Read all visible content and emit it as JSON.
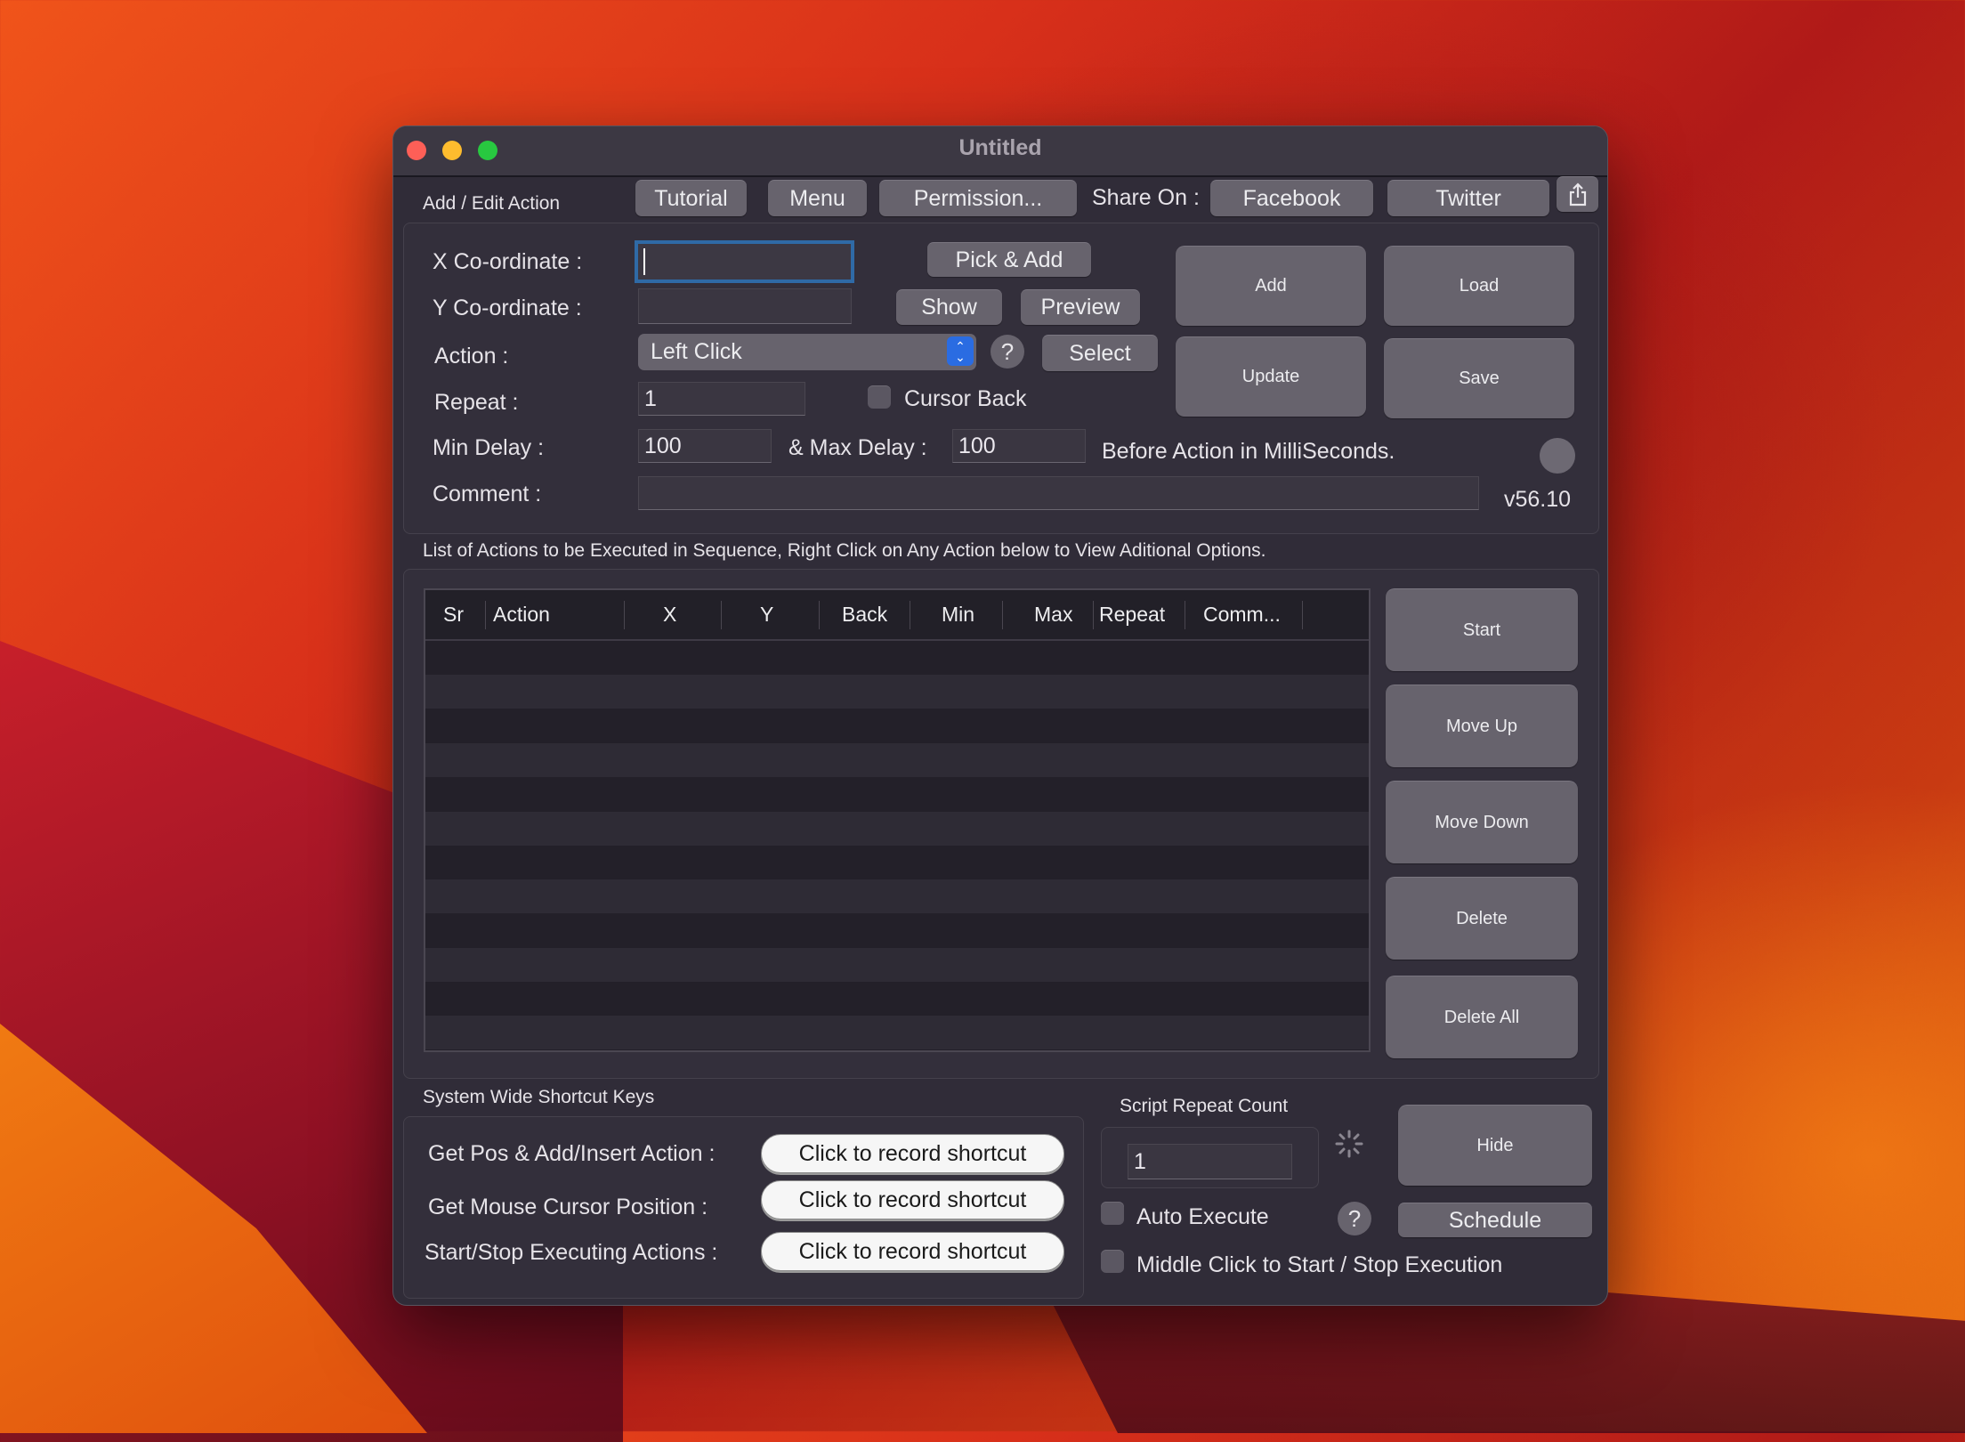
{
  "window": {
    "title": "Untitled"
  },
  "header": {
    "section_label": "Add / Edit Action",
    "tutorial": "Tutorial",
    "menu": "Menu",
    "permission": "Permission...",
    "share_on": "Share On :",
    "facebook": "Facebook",
    "twitter": "Twitter",
    "share_icon": "share-icon"
  },
  "form": {
    "x_label": "X Co-ordinate :",
    "x_value": "",
    "y_label": "Y Co-ordinate :",
    "y_value": "",
    "action_label": "Action :",
    "action_value": "Left Click",
    "repeat_label": "Repeat :",
    "repeat_value": "1",
    "cursor_back_label": "Cursor Back",
    "cursor_back_checked": false,
    "min_delay_label": "Min Delay :",
    "min_delay_value": "100",
    "max_delay_label": "& Max Delay :",
    "max_delay_value": "100",
    "delay_suffix": "Before Action in MilliSeconds.",
    "comment_label": "Comment :",
    "comment_value": "",
    "version": "v56.10",
    "pick_add": "Pick & Add",
    "show": "Show",
    "preview": "Preview",
    "help": "?",
    "select": "Select",
    "add": "Add",
    "load": "Load",
    "update": "Update",
    "save": "Save"
  },
  "list": {
    "caption": "List of Actions to be Executed in Sequence, Right Click on Any Action below to View Aditional Options.",
    "columns": [
      "Sr",
      "Action",
      "X",
      "Y",
      "Back",
      "Min",
      "Max",
      "Repeat",
      "Comm..."
    ],
    "rows": [],
    "buttons": {
      "start": "Start",
      "move_up": "Move Up",
      "move_down": "Move Down",
      "delete": "Delete",
      "delete_all": "Delete All"
    }
  },
  "shortcuts": {
    "title": "System Wide Shortcut Keys",
    "items": [
      {
        "label": "Get Pos & Add/Insert Action :",
        "button": "Click to record shortcut"
      },
      {
        "label": "Get Mouse Cursor Position :",
        "button": "Click to record shortcut"
      },
      {
        "label": "Start/Stop Executing Actions :",
        "button": "Click to record shortcut"
      }
    ]
  },
  "execution": {
    "repeat_count_label": "Script Repeat Count",
    "repeat_count_value": "1",
    "hide": "Hide",
    "auto_execute_label": "Auto Execute",
    "auto_execute_checked": false,
    "help": "?",
    "schedule": "Schedule",
    "middle_click_label": "Middle Click to Start / Stop Execution",
    "middle_click_checked": false
  },
  "colors": {
    "window_bg": "#302c38",
    "button_bg": "#67636d",
    "focus_ring": "#2f6aa6",
    "stepper_blue": "#2a6ce2"
  }
}
